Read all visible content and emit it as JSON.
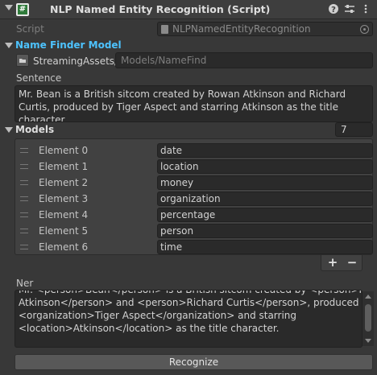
{
  "header": {
    "title": "NLP Named Entity Recognition (Script)",
    "script_icon_glyph": "#",
    "icons": [
      "help-icon",
      "presets-icon",
      "menu-icon"
    ]
  },
  "script_field": {
    "label": "Script",
    "value": "NLPNamedEntityRecognition"
  },
  "name_finder": {
    "label": "Name Finder Model",
    "label_color": "#4dc3ff",
    "root": "StreamingAssets/",
    "path": "Models/NameFind"
  },
  "sentence": {
    "label": "Sentence",
    "text": "Mr. Bean is a British sitcom created by Rowan Atkinson and Richard Curtis, produced by Tiger Aspect and starring Atkinson as the title character."
  },
  "models": {
    "label": "Models",
    "count": "7",
    "elements": [
      {
        "label": "Element 0",
        "value": "date"
      },
      {
        "label": "Element 1",
        "value": "location"
      },
      {
        "label": "Element 2",
        "value": "money"
      },
      {
        "label": "Element 3",
        "value": "organization"
      },
      {
        "label": "Element 4",
        "value": "percentage"
      },
      {
        "label": "Element 5",
        "value": "person"
      },
      {
        "label": "Element 6",
        "value": "time"
      }
    ],
    "add_label": "+",
    "remove_label": "−"
  },
  "ner": {
    "label": "Ner",
    "line_partial": "Mr. <person>Bean</person> is a British sitcom created by <person>Rowan",
    "line_1": "Atkinson</person> and <person>Richard Curtis</person>, produced by",
    "line_2": "<organization>Tiger Aspect</organization> and starring",
    "line_3": "<location>Atkinson</location> as the title character."
  },
  "recognize_button": "Recognize"
}
